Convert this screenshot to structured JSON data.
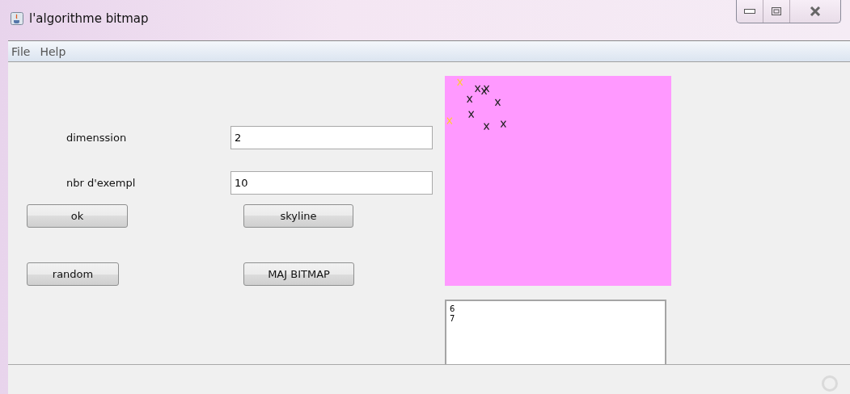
{
  "window": {
    "title": "l'algorithme bitmap"
  },
  "menu": [
    "File",
    "Help"
  ],
  "fields": [
    {
      "label": "dimenssion",
      "value": "2"
    },
    {
      "label": "nbr d'exempl",
      "value": "10"
    }
  ],
  "buttons": [
    "ok",
    "skyline",
    "random",
    "MAJ BITMAP"
  ],
  "output": {
    "lines": [
      "6",
      "7"
    ]
  }
}
